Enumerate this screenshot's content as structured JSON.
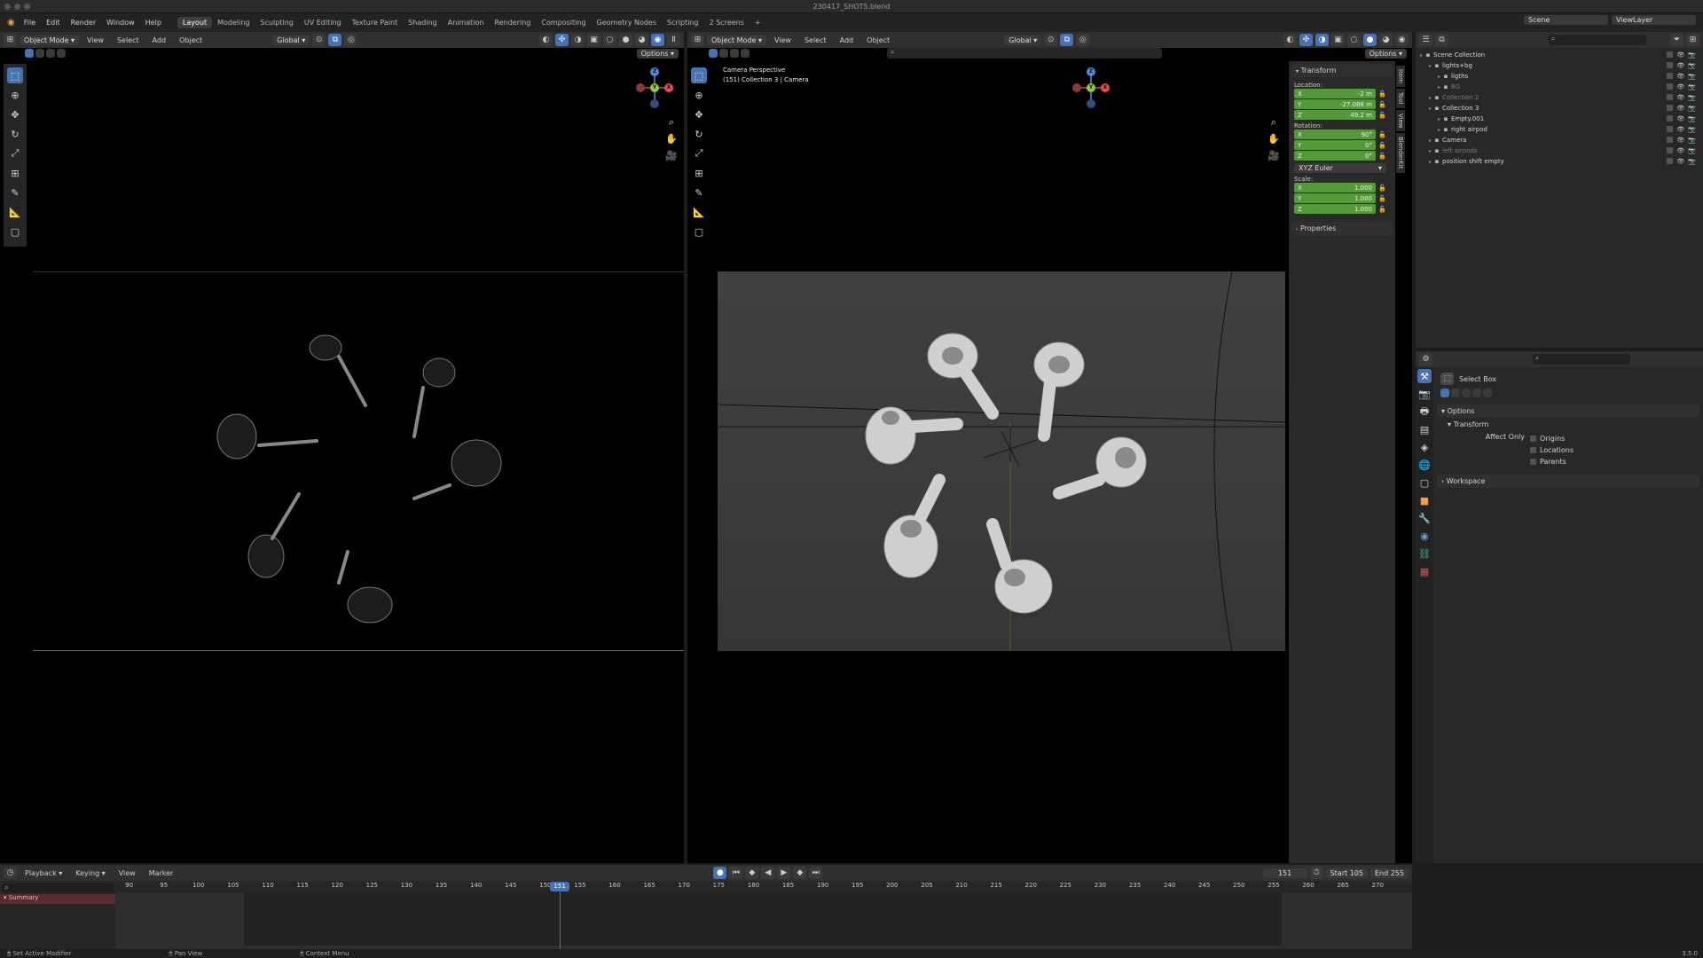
{
  "window": {
    "title": "230417_SHOT5.blend"
  },
  "menu": [
    "File",
    "Edit",
    "Render",
    "Window",
    "Help"
  ],
  "workspaces": [
    "Layout",
    "Modeling",
    "Sculpting",
    "UV Editing",
    "Texture Paint",
    "Shading",
    "Animation",
    "Rendering",
    "Compositing",
    "Geometry Nodes",
    "Scripting",
    "2 Screens"
  ],
  "active_workspace": "Layout",
  "topbar": {
    "scene_label": "Scene",
    "view_layer_label": "ViewLayer"
  },
  "left_view": {
    "mode": "Object Mode",
    "menus": [
      "View",
      "Select",
      "Add",
      "Object"
    ],
    "orientation": "Global",
    "options": "Options"
  },
  "right_view": {
    "mode": "Object Mode",
    "menus": [
      "View",
      "Select",
      "Add",
      "Object"
    ],
    "orientation": "Global",
    "options": "Options",
    "overlay_line1": "Camera Perspective",
    "overlay_line2": "(151) Collection 3 | Camera"
  },
  "gizmo": {
    "x": "X",
    "y": "Y",
    "z": "Z"
  },
  "n_panel": {
    "transform_title": "Transform",
    "location_label": "Location:",
    "location": [
      {
        "axis": "X",
        "value": "-2 m"
      },
      {
        "axis": "Y",
        "value": "-27.088 m"
      },
      {
        "axis": "Z",
        "value": "49.2 m"
      }
    ],
    "rotation_label": "Rotation:",
    "rotation": [
      {
        "axis": "X",
        "value": "90°"
      },
      {
        "axis": "Y",
        "value": "0°"
      },
      {
        "axis": "Z",
        "value": "0°"
      }
    ],
    "rotation_mode": "XYZ Euler",
    "scale_label": "Scale:",
    "scale": [
      {
        "axis": "X",
        "value": "1.000"
      },
      {
        "axis": "Y",
        "value": "1.000"
      },
      {
        "axis": "Z",
        "value": "1.000"
      }
    ],
    "properties_title": "Properties",
    "tabs": [
      "Item",
      "Tool",
      "View",
      "BlenderKit"
    ]
  },
  "outliner": {
    "items": [
      {
        "name": "Scene Collection",
        "indent": 0,
        "color": "#d8d8d8"
      },
      {
        "name": "lights+bg",
        "indent": 1,
        "color": "#d8d8d8"
      },
      {
        "name": "ligths",
        "indent": 2,
        "color": "#d8d8d8"
      },
      {
        "name": "BG",
        "indent": 2,
        "color": "#7a7a7a"
      },
      {
        "name": "Collection 2",
        "indent": 1,
        "color": "#7a7a7a"
      },
      {
        "name": "Collection 3",
        "indent": 1,
        "color": "#d8d8d8"
      },
      {
        "name": "Empty.001",
        "indent": 2,
        "color": "#d8d8d8"
      },
      {
        "name": "right airpod",
        "indent": 2,
        "color": "#d8d8d8"
      },
      {
        "name": "Camera",
        "indent": 1,
        "color": "#d8d8d8"
      },
      {
        "name": "left airpods",
        "indent": 1,
        "color": "#7a7a7a"
      },
      {
        "name": "position shift empty",
        "indent": 1,
        "color": "#d8d8d8"
      }
    ]
  },
  "properties": {
    "tool_name": "Select Box",
    "options_title": "Options",
    "transform_title": "Transform",
    "affect_only": "Affect Only",
    "checks": [
      "Origins",
      "Locations",
      "Parents"
    ],
    "workspace_title": "Workspace"
  },
  "timeline": {
    "menus": [
      "Playback",
      "Keying",
      "View",
      "Marker"
    ],
    "current_frame": "151",
    "start_label": "Start",
    "start": "105",
    "end_label": "End",
    "end": "255",
    "summary": "Summary",
    "ticks": [
      "90",
      "95",
      "100",
      "105",
      "110",
      "115",
      "120",
      "125",
      "130",
      "135",
      "140",
      "145",
      "150",
      "155",
      "160",
      "165",
      "170",
      "175",
      "180",
      "185",
      "190",
      "195",
      "200",
      "205",
      "210",
      "215",
      "220",
      "225",
      "230",
      "235",
      "240",
      "245",
      "250",
      "255",
      "260",
      "265",
      "270"
    ]
  },
  "statusbar": {
    "items": [
      "Set Active Modifier",
      "Pan View",
      "Context Menu"
    ],
    "version": "3.5.0"
  },
  "colors": {
    "accent": "#4772b3",
    "field_green": "#58983c",
    "background": "#1d1d1d"
  }
}
